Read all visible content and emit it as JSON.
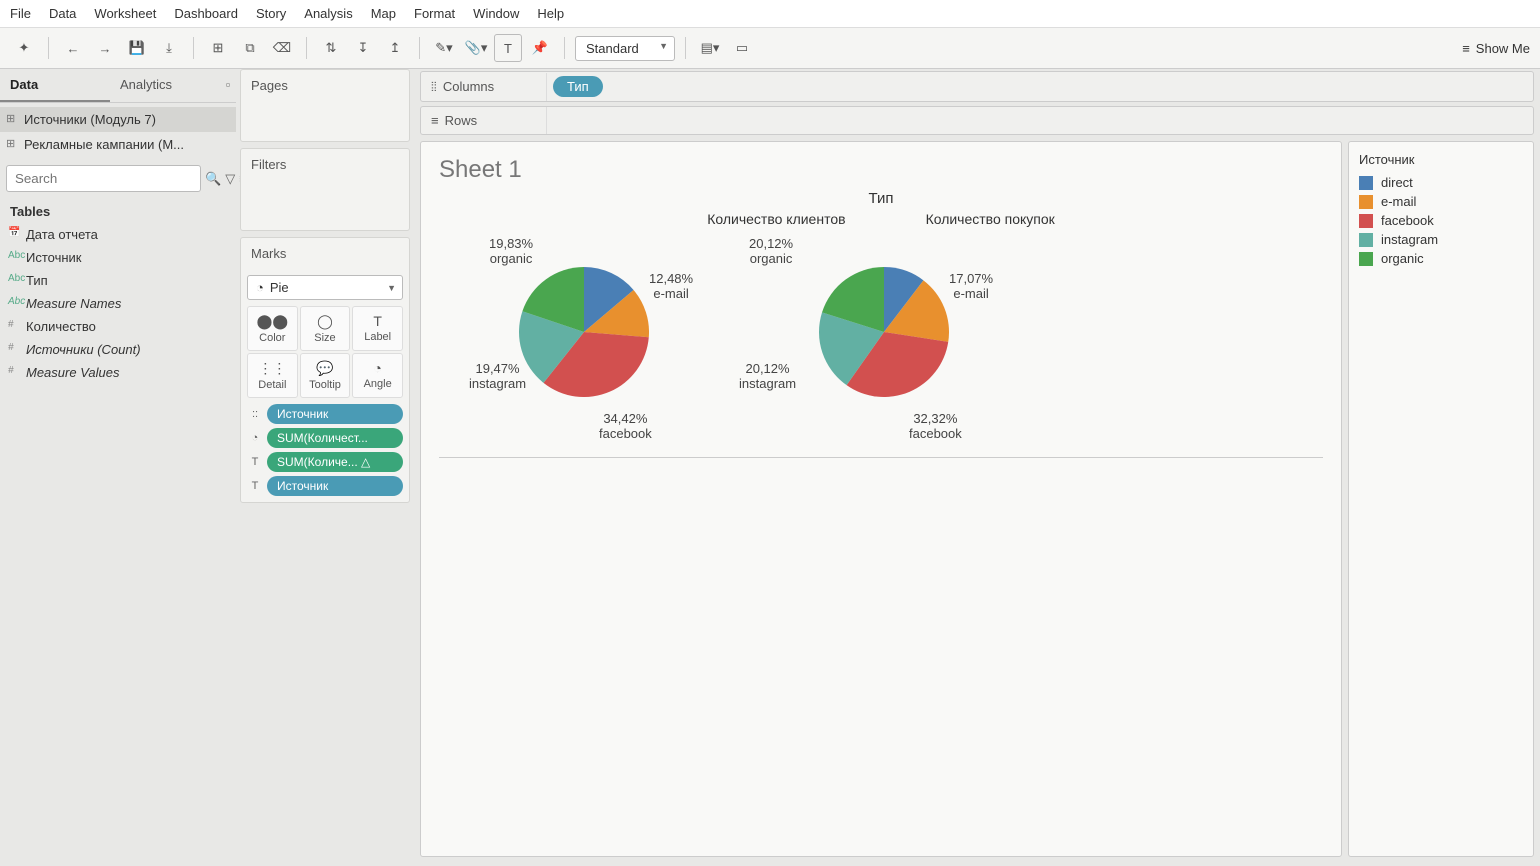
{
  "menu": [
    "File",
    "Data",
    "Worksheet",
    "Dashboard",
    "Story",
    "Analysis",
    "Map",
    "Format",
    "Window",
    "Help"
  ],
  "toolbar": {
    "fit": "Standard",
    "showme": "Show Me"
  },
  "sidebar": {
    "tabs": [
      "Data",
      "Analytics"
    ],
    "datasources": [
      "Источники (Модуль 7)",
      "Рекламные кампании (М..."
    ],
    "search_placeholder": "Search",
    "tables_header": "Tables",
    "fields": [
      {
        "icon": "📅",
        "label": "Дата отчета",
        "cls": ""
      },
      {
        "icon": "Abc",
        "label": "Источник",
        "cls": ""
      },
      {
        "icon": "Abc",
        "label": "Тип",
        "cls": ""
      },
      {
        "icon": "Abc",
        "label": "Measure Names",
        "cls": "italic"
      },
      {
        "icon": "#",
        "label": "Количество",
        "cls": "num"
      },
      {
        "icon": "#",
        "label": "Источники (Count)",
        "cls": "num italic"
      },
      {
        "icon": "#",
        "label": "Measure Values",
        "cls": "num italic"
      }
    ]
  },
  "cards": {
    "pages": "Pages",
    "filters": "Filters",
    "marks": "Marks",
    "mark_type": "Pie",
    "mark_cells": [
      "Color",
      "Size",
      "Label",
      "Detail",
      "Tooltip",
      "Angle"
    ],
    "pills": [
      {
        "pre": "::",
        "cls": "blue",
        "label": "Источник"
      },
      {
        "pre": "◔",
        "cls": "green",
        "label": "SUM(Количест..."
      },
      {
        "pre": "T",
        "cls": "green",
        "label": "SUM(Количе... △"
      },
      {
        "pre": "T",
        "cls": "blue",
        "label": "Источник"
      }
    ]
  },
  "shelves": {
    "columns": "Columns",
    "rows": "Rows",
    "col_pill": "Тип"
  },
  "viz": {
    "title": "Sheet 1",
    "column_dim": "Тип",
    "sub": [
      "Количество клиентов",
      "Количество покупок"
    ]
  },
  "legend": {
    "title": "Источник",
    "items": [
      {
        "c": "#4a7fb5",
        "l": "direct"
      },
      {
        "c": "#e8902e",
        "l": "e-mail"
      },
      {
        "c": "#d2504f",
        "l": "facebook"
      },
      {
        "c": "#62b0a3",
        "l": "instagram"
      },
      {
        "c": "#4aa64f",
        "l": "organic"
      }
    ]
  },
  "chart_data": [
    {
      "type": "pie",
      "title": "Количество клиентов",
      "series": [
        {
          "name": "direct",
          "value": 13.8,
          "color": "#4a7fb5"
        },
        {
          "name": "e-mail",
          "value": 12.48,
          "color": "#e8902e"
        },
        {
          "name": "facebook",
          "value": 34.42,
          "color": "#d2504f"
        },
        {
          "name": "instagram",
          "value": 19.47,
          "color": "#62b0a3"
        },
        {
          "name": "organic",
          "value": 19.83,
          "color": "#4aa64f"
        }
      ],
      "labels": [
        {
          "text": "19,83%\norganic",
          "x": 20,
          "y": 0
        },
        {
          "text": "12,48%\ne-mail",
          "x": 180,
          "y": 35
        },
        {
          "text": "19,47%\ninstagram",
          "x": 0,
          "y": 125
        },
        {
          "text": "34,42%\nfacebook",
          "x": 130,
          "y": 175
        }
      ]
    },
    {
      "type": "pie",
      "title": "Количество покупок",
      "series": [
        {
          "name": "direct",
          "value": 10.37,
          "color": "#4a7fb5"
        },
        {
          "name": "e-mail",
          "value": 17.07,
          "color": "#e8902e"
        },
        {
          "name": "facebook",
          "value": 32.32,
          "color": "#d2504f"
        },
        {
          "name": "instagram",
          "value": 20.12,
          "color": "#62b0a3"
        },
        {
          "name": "organic",
          "value": 20.12,
          "color": "#4aa64f"
        }
      ],
      "labels": [
        {
          "text": "20,12%\norganic",
          "x": -20,
          "y": 0
        },
        {
          "text": "17,07%\ne-mail",
          "x": 180,
          "y": 35
        },
        {
          "text": "20,12%\ninstagram",
          "x": -30,
          "y": 125
        },
        {
          "text": "32,32%\nfacebook",
          "x": 140,
          "y": 175
        }
      ]
    }
  ]
}
